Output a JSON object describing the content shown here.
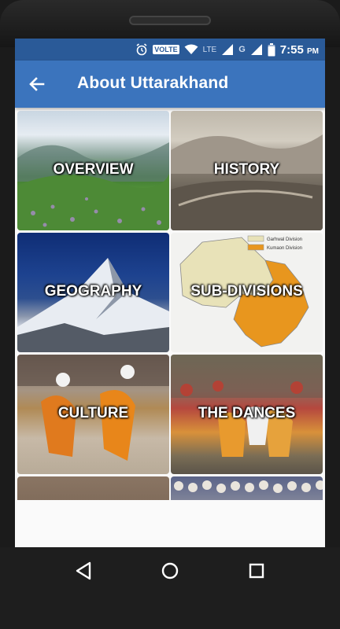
{
  "status_bar": {
    "volte_label": "VOLTE",
    "lte_label": "LTE",
    "g_label": "G",
    "time": "7:55",
    "ampm": "PM"
  },
  "app_bar": {
    "title": "About Uttarakhand"
  },
  "tiles": [
    {
      "label": "OVERVIEW"
    },
    {
      "label": "HISTORY"
    },
    {
      "label": "GEOGRAPHY"
    },
    {
      "label": "SUB-DIVISIONS"
    },
    {
      "label": "CULTURE"
    },
    {
      "label": "THE DANCES"
    }
  ],
  "map_legend": {
    "garhwal": "Garhwal Division",
    "kumaon": "Kumaon Division",
    "garhwal_color": "#e8e2b8",
    "kumaon_color": "#e8961e"
  },
  "colors": {
    "status_bar": "#2a5a98",
    "app_bar": "#3b74bd"
  }
}
